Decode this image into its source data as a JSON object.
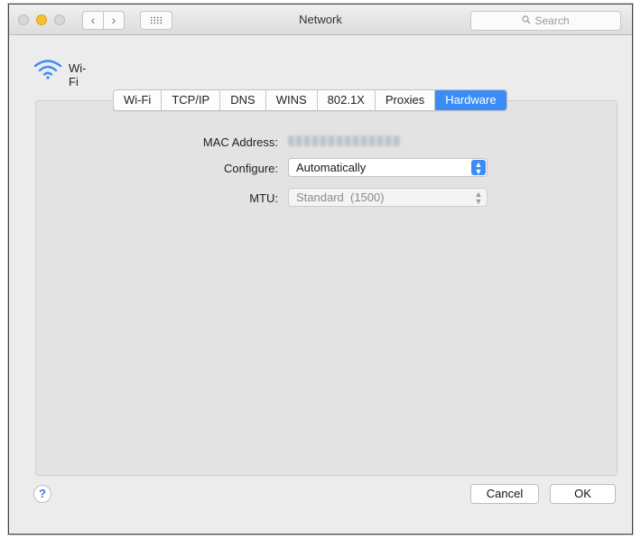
{
  "window": {
    "title": "Network",
    "search_placeholder": "Search",
    "nav": {
      "back": "‹",
      "forward": "›"
    }
  },
  "service": {
    "name": "Wi-Fi",
    "icon": "wifi-icon"
  },
  "tabs": [
    {
      "label": "Wi-Fi",
      "selected": false
    },
    {
      "label": "TCP/IP",
      "selected": false
    },
    {
      "label": "DNS",
      "selected": false
    },
    {
      "label": "WINS",
      "selected": false
    },
    {
      "label": "802.1X",
      "selected": false
    },
    {
      "label": "Proxies",
      "selected": false
    },
    {
      "label": "Hardware",
      "selected": true
    }
  ],
  "hardware": {
    "mac_label": "MAC Address:",
    "configure_label": "Configure:",
    "configure_value": "Automatically",
    "mtu_label": "MTU:",
    "mtu_value": "Standard  (1500)"
  },
  "buttons": {
    "cancel": "Cancel",
    "ok": "OK",
    "help": "?"
  },
  "colors": {
    "accent": "#3b8cf7",
    "minimize": "#f5c02e"
  }
}
